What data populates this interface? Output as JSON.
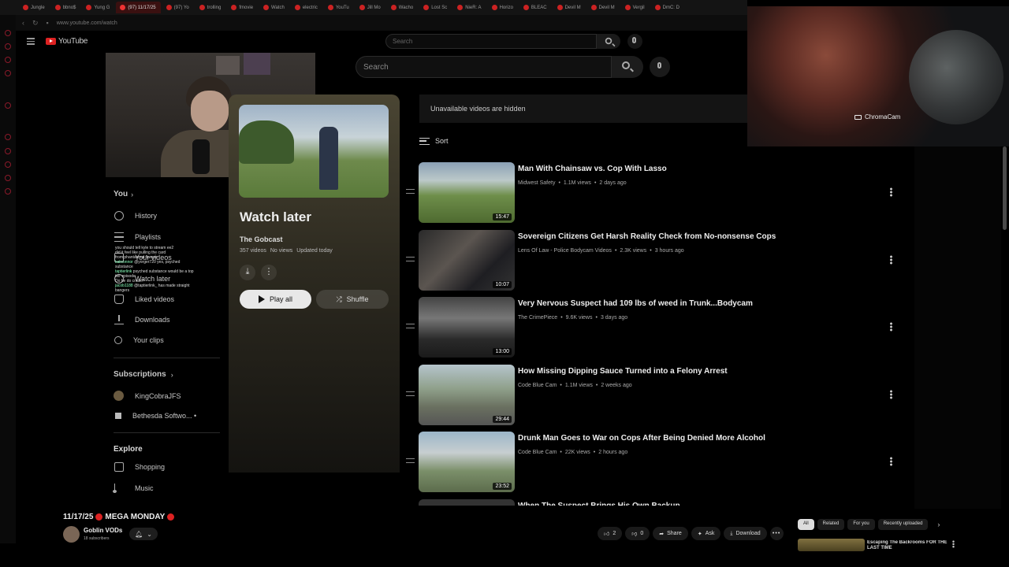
{
  "browser": {
    "tabs": [
      {
        "label": "Jungle",
        "active": false
      },
      {
        "label": "bbno$",
        "active": false
      },
      {
        "label": "Yung G",
        "active": false
      },
      {
        "label": "(97) 11/17/25",
        "active": true
      },
      {
        "label": "(97) Yo",
        "active": false
      },
      {
        "label": "trolling",
        "active": false
      },
      {
        "label": "fmovie",
        "active": false
      },
      {
        "label": "Watch",
        "active": false
      },
      {
        "label": "electric",
        "active": false
      },
      {
        "label": "YouTu",
        "active": false
      },
      {
        "label": "Jill Mo",
        "active": false
      },
      {
        "label": "Wacho",
        "active": false
      },
      {
        "label": "Lost Sc",
        "active": false
      },
      {
        "label": "NieR: A",
        "active": false
      },
      {
        "label": "Horizo",
        "active": false
      },
      {
        "label": "BLEAC",
        "active": false
      },
      {
        "label": "Devil M",
        "active": false
      },
      {
        "label": "Devil M",
        "active": false
      },
      {
        "label": "Vergil",
        "active": false
      },
      {
        "label": "DmC: D",
        "active": false
      }
    ],
    "url": "www.youtube.com/watch"
  },
  "youtube": {
    "logo_text": "YouTube",
    "search_small_placeholder": "Search",
    "search_big_placeholder": "Search"
  },
  "guide": {
    "you_label": "You",
    "you_chevron": "›",
    "items": [
      {
        "label": "History",
        "icon": "history-icon"
      },
      {
        "label": "Playlists",
        "icon": "playlists-icon"
      },
      {
        "label": "Your videos",
        "icon": "your-videos-icon"
      },
      {
        "label": "Watch later",
        "icon": "watch-later-icon"
      },
      {
        "label": "Liked videos",
        "icon": "liked-icon"
      },
      {
        "label": "Downloads",
        "icon": "download-icon"
      },
      {
        "label": "Your clips",
        "icon": "clips-icon"
      }
    ],
    "subscriptions_label": "Subscriptions",
    "subscriptions": [
      {
        "label": "KingCobraJFS"
      },
      {
        "label": "Bethesda Softwo... •"
      }
    ],
    "explore_label": "Explore",
    "explore_items": [
      {
        "label": "Shopping"
      },
      {
        "label": "Music"
      }
    ]
  },
  "chat": [
    {
      "name": "",
      "text": "you should tell kyle to stream ee2"
    },
    {
      "name": "",
      "text": "did it feel like pulling the card"
    },
    {
      "name": "",
      "text": "from phantasmal flames"
    },
    {
      "name": "kaliconnor",
      "text": "@yorger720 yes, psyched"
    },
    {
      "name": "",
      "text": "substance"
    },
    {
      "name": "taptierlink",
      "text": "psyched substance would be a top"
    },
    {
      "name": "",
      "text": "tier episode"
    },
    {
      "name": "",
      "text": "Do he do crack?"
    },
    {
      "name": "jacob1188",
      "text": "@taptierlink_ has made straight"
    },
    {
      "name": "",
      "text": "bangers"
    }
  ],
  "playlist": {
    "title": "Watch later",
    "owner": "The Gobcast",
    "video_count": "357 videos",
    "views": "No views",
    "updated": "Updated today",
    "play_all": "Play all",
    "shuffle": "Shuffle"
  },
  "list": {
    "notice": "Unavailable videos are hidden",
    "sort_label": "Sort",
    "videos": [
      {
        "title": "Man With Chainsaw vs. Cop With Lasso",
        "channel": "Midwest Safety",
        "views": "1.1M views",
        "age": "2 days ago",
        "duration": "15:47"
      },
      {
        "title": "Sovereign Citizens Get Harsh Reality Check from No-nonsense Cops",
        "channel": "Lens Of Law - Police Bodycam Videos",
        "views": "2.3K views",
        "age": "3 hours ago",
        "duration": "10:07"
      },
      {
        "title": "Very Nervous Suspect had 109 lbs of weed in Trunk...Bodycam",
        "channel": "The CrimePiece",
        "views": "9.6K views",
        "age": "3 days ago",
        "duration": "13:00"
      },
      {
        "title": "How Missing Dipping Sauce Turned into a Felony Arrest",
        "channel": "Code Blue Cam",
        "views": "1.1M views",
        "age": "2 weeks ago",
        "duration": "29:44"
      },
      {
        "title": "Drunk Man Goes to War on Cops After Being Denied More Alcohol",
        "channel": "Code Blue Cam",
        "views": "22K views",
        "age": "2 hours ago",
        "duration": "23:52"
      },
      {
        "title": "When The Suspect Brings His Own Backup",
        "channel": "",
        "views": "",
        "age": "",
        "duration": ""
      }
    ]
  },
  "overlay": {
    "chroma_label": "ChromaCam"
  },
  "bottom": {
    "stream_date": "11/17/25",
    "stream_title": "MEGA MONDAY",
    "channel_name": "Goblin VODs",
    "channel_subs": "18 subscribers",
    "likes": "2",
    "dislikes": "0",
    "share": "Share",
    "ask": "Ask",
    "download": "Download",
    "more": "•••",
    "chips": [
      "All",
      "Related",
      "For you",
      "Recently uploaded"
    ],
    "related_title": "Escaping The Backrooms FOR THE LAST TIME"
  }
}
